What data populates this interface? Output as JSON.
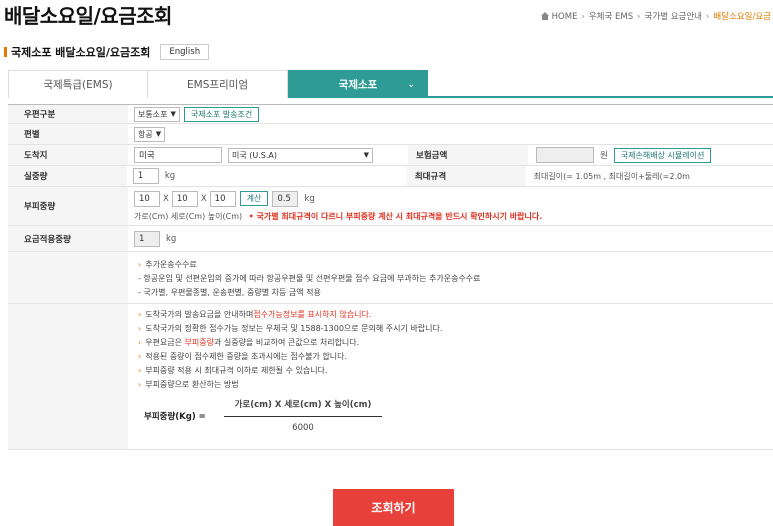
{
  "header": {
    "title": "배달소요일/요금조회",
    "breadcrumb": [
      "HOME",
      "우체국 EMS",
      "국가별 요금안내",
      "배달소요일/요금"
    ]
  },
  "section": {
    "title": "국제소포 배달소요일/요금조회",
    "english_label": "English"
  },
  "tabs": [
    {
      "label": "국제특급(EMS)"
    },
    {
      "label": "EMS프리미엄"
    },
    {
      "label": "국제소포",
      "active": true
    }
  ],
  "form": {
    "mail_type": {
      "label": "우편구분",
      "value": "보통소포",
      "condition_button": "국제소포 발송조건"
    },
    "service": {
      "label": "편별",
      "value": "항공"
    },
    "destination": {
      "label": "도착지",
      "search_value": "미국",
      "select_value": "미국 (U.S.A)"
    },
    "insurance": {
      "label": "보험금액",
      "value": "",
      "unit": "원",
      "sim_button": "국제손해배상 시뮬레이션"
    },
    "actual_weight": {
      "label": "실중량",
      "value": "1",
      "unit": "kg"
    },
    "max_size": {
      "label": "최대규격",
      "text": "최대길이(= 1.05m , 최대길이+둘레(=2.0m"
    },
    "volume_weight": {
      "label": "부피중량",
      "width": "10",
      "depth": "10",
      "height": "10",
      "times": "X",
      "calc_button": "계산",
      "result": "0.5",
      "unit": "kg",
      "hint": "가로(Cm) 세로(Cm) 높이(Cm)",
      "warning": "• 국가별 최대규격이 다르니 부피중량 계산 시 최대규격을 반드시 확인하시기 바랍니다."
    },
    "applied_weight": {
      "label": "요금적용중량",
      "value": "1",
      "unit": "kg"
    }
  },
  "notes1": {
    "title": "추가운송수수료",
    "lines": [
      "- 항공운임 및 선편운임의 증가에 따라 항공우편물 및 선편우편물 접수 요금에 부과하는 추가운송수수료",
      "- 국가별, 우편물종별, 운송편별, 중량별 차등 금액 적용"
    ]
  },
  "notes2": {
    "l1_a": "도착국가의 발송요금을 안내하며",
    "l1_b": "접수가능정보를 표시하지 않습니다.",
    "l2": "도착국가의 정확한 접수가능 정보는 우체국 및 1588-1300으로 문의해 주시기 바랍니다.",
    "l3_a": "우편요금은 ",
    "l3_b": "부피중량",
    "l3_c": "과 실중량을 비교하여 큰값으로 처리합니다.",
    "l4": "적용된 중량이 접수제한 중량을 초과시에는 접수불가 합니다.",
    "l5": "부피중량 적용 시 최대규격 이하로 제한될 수 있습니다.",
    "l6": "부피중량으로 환산하는 방법",
    "formula_label": "부피중량(Kg) =",
    "formula_num": "가로(cm) X 세로(cm) X 높이(cm)",
    "formula_den": "6000"
  },
  "submit_label": "조회하기"
}
